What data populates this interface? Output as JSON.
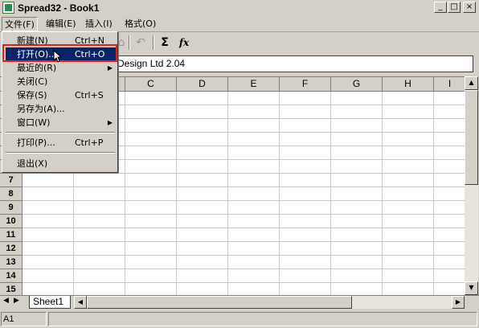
{
  "window": {
    "title": "Spread32 - Book1",
    "min": "_",
    "max": "□",
    "close": "×"
  },
  "menubar": [
    {
      "label": "文件(F)"
    },
    {
      "label": "编辑(E)"
    },
    {
      "label": "插入(I)"
    },
    {
      "label": "格式(O)"
    }
  ],
  "toolbar": {
    "sum": "Σ",
    "fx": "fx",
    "undo": "↶"
  },
  "formula_bar": {
    "text": "Design Ltd  2.04"
  },
  "columns": [
    "C",
    "D",
    "E",
    "F",
    "G",
    "H",
    "I"
  ],
  "rows": [
    "7",
    "8",
    "9",
    "10",
    "11",
    "12",
    "13",
    "14",
    "15"
  ],
  "file_menu": {
    "items": [
      {
        "label": "新建(N)",
        "shortcut": "Ctrl+N"
      },
      {
        "label": "打开(O)...",
        "shortcut": "Ctrl+O"
      },
      {
        "label": "最近的(R)",
        "shortcut": ""
      },
      {
        "label": "关闭(C)",
        "shortcut": ""
      },
      {
        "label": "保存(S)",
        "shortcut": "Ctrl+S"
      },
      {
        "label": "另存为(A)...",
        "shortcut": ""
      },
      {
        "label": "窗口(W)",
        "shortcut": ""
      },
      {
        "label": "打印(P)...",
        "shortcut": "Ctrl+P"
      },
      {
        "label": "退出(X)",
        "shortcut": ""
      }
    ]
  },
  "sheet_tab": "Sheet1",
  "status": {
    "cell": "A1"
  },
  "colors": {
    "highlight": "#0a246a",
    "annotation_box": "#e02020"
  }
}
